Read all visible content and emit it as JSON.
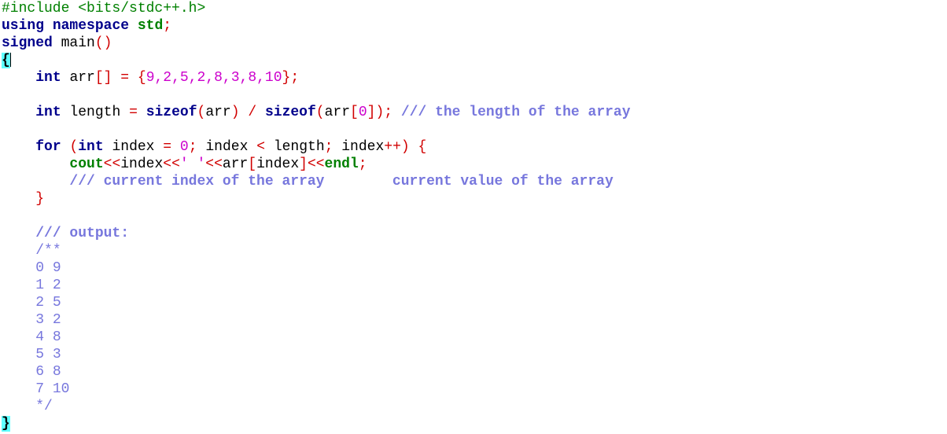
{
  "editor": {
    "lines": {
      "l1": {
        "include": "#include <bits/stdc++.h>"
      },
      "l2": {
        "using": "using",
        "namespace": "namespace",
        "std": "std",
        "semi": ";"
      },
      "l3": {
        "signed": "signed",
        "main": "main",
        "parens": "()"
      },
      "l4": {
        "brace": "{"
      },
      "l5": {
        "int": "int",
        "name": "arr",
        "brackets": "[]",
        "eq": "=",
        "open": "{",
        "values": "9,2,5,2,8,3,8,10",
        "close": "};"
      },
      "l7": {
        "int": "int",
        "name": "length",
        "eq": "=",
        "sizeof1": "sizeof",
        "arg1_open": "(",
        "arg1": "arr",
        "arg1_close": ")",
        "div": "/",
        "sizeof2": "sizeof",
        "arg2_open": "(",
        "arg2": "arr",
        "idx_open": "[",
        "idx": "0",
        "idx_close": "]",
        "arg2_close": ")",
        "semi": ";",
        "comment": "/// the length of the array"
      },
      "l9": {
        "for": "for",
        "paren_open": "(",
        "int": "int",
        "init_var": "index",
        "eq": "=",
        "zero": "0",
        "semi1": ";",
        "cond_var": "index",
        "lt": "<",
        "limit": "length",
        "semi2": ";",
        "inc_var": "index",
        "inc": "++)",
        "brace": "{"
      },
      "l10": {
        "cout": "cout",
        "shl1": "<<",
        "index": "index",
        "shl2": "<<",
        "space_char": "' '",
        "shl3": "<<",
        "arr": "arr",
        "idx_open": "[",
        "idx": "index",
        "idx_close": "]",
        "shl4": "<<",
        "endl": "endl",
        "semi": ";"
      },
      "l11": {
        "comment_a": "/// current index of the array",
        "comment_b": "current value of the array"
      },
      "l12": {
        "brace": "}"
      },
      "l14": {
        "comment": "/// output:"
      },
      "l15": {
        "doc_open": "/**"
      },
      "output": [
        "0 9",
        "1 2",
        "2 5",
        "3 2",
        "4 8",
        "5 3",
        "6 8",
        "7 10"
      ],
      "l24": {
        "doc_close": "*/"
      },
      "l25": {
        "brace": "}"
      }
    }
  }
}
